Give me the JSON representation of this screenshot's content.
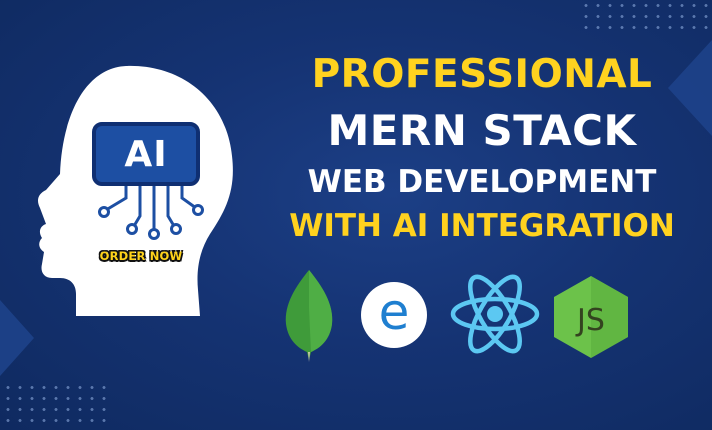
{
  "banner": {
    "headline": {
      "line1": "PROFESSIONAL",
      "line2": "MERN STACK",
      "line3": "WEB DEVELOPMENT",
      "line4": "WITH AI INTEGRATION"
    },
    "ai_badge": "AI",
    "cta": "ORDER NOW",
    "logos": {
      "express_letter": "e",
      "node_text": "JS"
    }
  },
  "colors": {
    "background": "#153373",
    "accent_yellow": "#ffd21f",
    "mongodb_green": "#3f9b3a",
    "react_blue": "#5cc8f2",
    "node_green": "#6cc24a"
  },
  "icons": [
    "head-silhouette-icon",
    "ai-chip-icon",
    "mongodb-logo-icon",
    "express-logo-icon",
    "react-logo-icon",
    "nodejs-logo-icon"
  ]
}
